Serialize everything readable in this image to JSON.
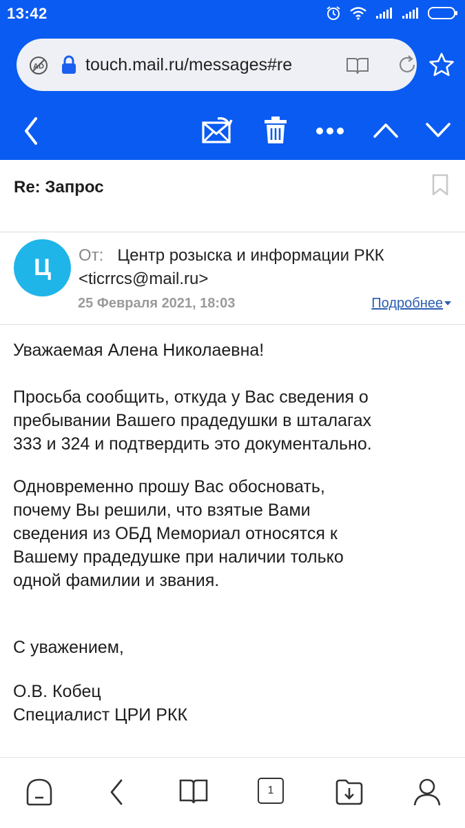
{
  "status_bar": {
    "time": "13:42",
    "icons": [
      "alarm-icon",
      "wifi-icon",
      "signal-icon",
      "signal-icon",
      "battery-icon"
    ]
  },
  "browser": {
    "url": "touch.mail.ru/messages#re",
    "icons": [
      "adblock-icon",
      "lock-icon",
      "reader-mode-icon",
      "reload-icon",
      "star-icon"
    ]
  },
  "mail_toolbar": {
    "icons": [
      "back-icon",
      "move-to-spam-icon",
      "trash-icon",
      "more-icon",
      "previous-icon",
      "next-icon"
    ]
  },
  "message": {
    "subject": "Re: Запрос",
    "avatar_letter": "Ц",
    "avatar_color": "#1fb5e8",
    "from_label": "От:",
    "from_name": "Центр розыска и информации РКК",
    "from_email": "<ticrrcs@mail.ru>",
    "date": "25 Февраля 2021, 18:03",
    "details_link": "Подробнее",
    "body": {
      "greeting": "Уважаемая Алена Николаевна!",
      "paragraph1": "Просьба сообщить, откуда у Вас сведения о\nпребывании Вашего прадедушки в шталагах\n333 и 324 и подтвердить это документально.",
      "paragraph2": "Одновременно прошу Вас обосновать,\nпочему Вы решили, что взятые Вами\nсведения из ОБД Мемориал относятся к\nВашему прадедушке при наличии только\nодной фамилии и звания.",
      "closing": "С уважением,",
      "signature_name": "О.В. Кобец",
      "signature_title": "Специалист ЦРИ РКК"
    }
  },
  "bottom_nav": {
    "tab_count": "1",
    "icons": [
      "home-icon",
      "back-icon",
      "bookmarks-icon",
      "tabs-icon",
      "downloads-icon",
      "profile-icon"
    ]
  },
  "colors": {
    "brand_blue": "#0a5bf2",
    "link": "#2a5db0"
  }
}
